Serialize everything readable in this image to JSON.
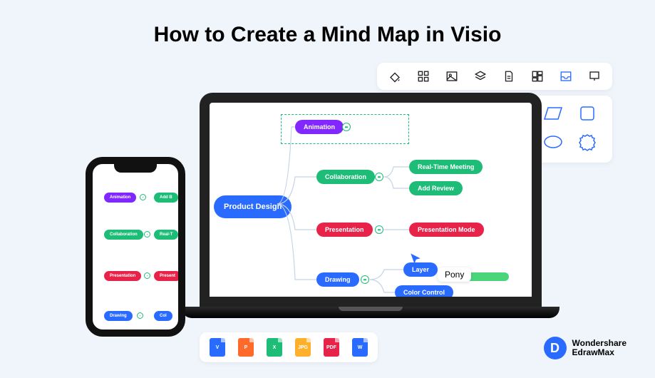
{
  "title": "How to Create a Mind Map in Visio",
  "toolbar_icons": [
    "fill",
    "apps",
    "image",
    "layers",
    "file",
    "dashboard",
    "inbox",
    "pin"
  ],
  "mindmap": {
    "root": "Product Design",
    "branches": {
      "animation": "Animation",
      "collaboration": "Collaboration",
      "presentation": "Presentation",
      "drawing": "Drawing"
    },
    "leaves": {
      "addB": "Add B",
      "realtime": "Real-Time Meeting",
      "addReview": "Add Review",
      "presentationMode": "Presentation Mode",
      "layer": "Layer",
      "colorControl": "Color Control"
    },
    "phone_leaves": {
      "addB": "Add B",
      "realT": "Real-T",
      "present": "Present",
      "col": "Col"
    }
  },
  "cursor_label": "Pony",
  "files": {
    "v": "V",
    "p": "P",
    "x": "X",
    "jpg": "JPG",
    "pdf": "PDF",
    "w": "W"
  },
  "brand": {
    "top": "Wondershare",
    "bottom": "EdrawMax",
    "mark": "D"
  }
}
